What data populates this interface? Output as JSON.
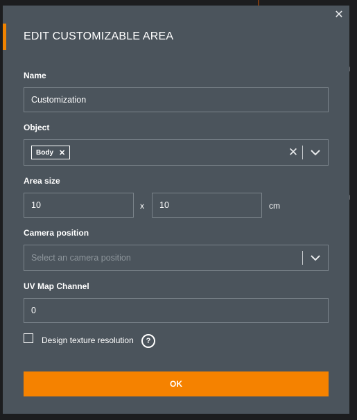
{
  "background": {
    "text_a": "n",
    "text_b": "n"
  },
  "modal": {
    "title": "EDIT CUSTOMIZABLE AREA",
    "close_icon": "close-icon",
    "accent_color": "#f08300"
  },
  "fields": {
    "name": {
      "label": "Name",
      "value": "Customization"
    },
    "object": {
      "label": "Object",
      "chip": "Body",
      "chip_remove": "✕",
      "clear": "✕"
    },
    "area_size": {
      "label": "Area size",
      "width": "10",
      "separator": "x",
      "height": "10",
      "unit": "cm"
    },
    "camera": {
      "label": "Camera position",
      "placeholder": "Select an camera position"
    },
    "uv": {
      "label": "UV Map Channel",
      "value": "0"
    },
    "design_texture": {
      "label": "Design texture resolution",
      "checked": false,
      "help": "?"
    }
  },
  "ok_button": {
    "label": "OK",
    "color": "#f58200"
  }
}
